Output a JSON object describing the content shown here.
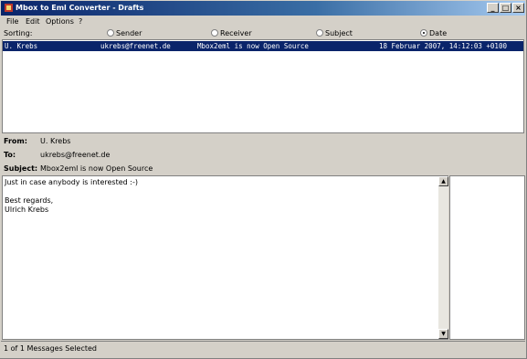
{
  "window": {
    "title": "Mbox to Eml Converter - Drafts",
    "controls": {
      "minimize": "_",
      "maximize": "□",
      "close": "×"
    }
  },
  "menubar": {
    "items": [
      "File",
      "Edit",
      "Options",
      "?"
    ]
  },
  "sorting": {
    "label": "Sorting:",
    "options": [
      {
        "label": "Sender",
        "selected": false
      },
      {
        "label": "Receiver",
        "selected": false
      },
      {
        "label": "Subject",
        "selected": false
      },
      {
        "label": "Date",
        "selected": true
      }
    ]
  },
  "messages": [
    {
      "sender": "U. Krebs",
      "receiver": "ukrebs@freenet.de",
      "subject": "Mbox2eml is now Open Source",
      "date": "18 Februar 2007, 14:12:03 +0100",
      "selected": true
    }
  ],
  "header": {
    "from_label": "From:",
    "from_value": "U. Krebs",
    "to_label": "To:",
    "to_value": "ukrebs@freenet.de",
    "subject_label": "Subject:",
    "subject_value": "Mbox2eml is now Open Source"
  },
  "body": {
    "lines": [
      "Just in case anybody is interested :-)",
      "",
      "Best regards,",
      "Ulrich Krebs"
    ]
  },
  "status": {
    "text": "1 of 1 Messages Selected"
  },
  "colors": {
    "titlebar": "#0a246a",
    "selection": "#0a246a",
    "chrome": "#d4d0c8"
  }
}
